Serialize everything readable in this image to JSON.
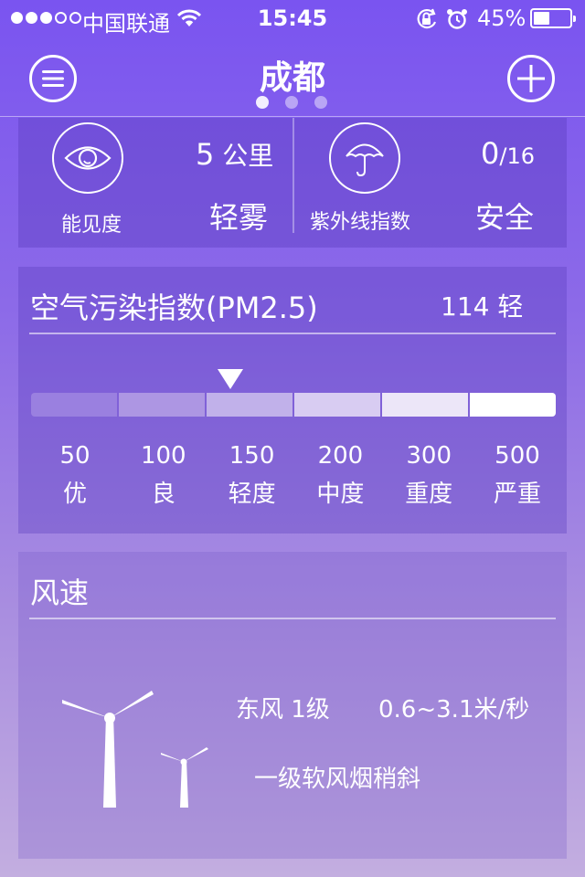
{
  "status_bar": {
    "carrier": "中国联通",
    "time": "15:45",
    "battery_percent": "45%",
    "battery_level": 0.45,
    "signal_bars_filled": 3
  },
  "header": {
    "city": "成都",
    "page_count": 3,
    "active_page": 0
  },
  "visibility": {
    "label": "能见度",
    "value": "5",
    "unit": "公里",
    "description": "轻雾"
  },
  "uv": {
    "label": "紫外线指数",
    "value": "0",
    "max": "/16",
    "description": "安全"
  },
  "air_quality": {
    "title": "空气污染指数(PM2.5)",
    "value": "114 轻",
    "aqi": 114,
    "levels": [
      {
        "value": "50",
        "name": "优"
      },
      {
        "value": "100",
        "name": "良"
      },
      {
        "value": "150",
        "name": "轻度"
      },
      {
        "value": "200",
        "name": "中度"
      },
      {
        "value": "300",
        "name": "重度"
      },
      {
        "value": "500",
        "name": "严重"
      }
    ],
    "scale_colors": [
      "#9a80e0",
      "#ad96e3",
      "#c1b1ea",
      "#d8ccf2",
      "#ece6f8",
      "#ffffff"
    ]
  },
  "wind": {
    "title": "风速",
    "direction_level": "东风  1级",
    "speed": "0.6~3.1米/秒",
    "description": "一级软风烟稍斜"
  }
}
